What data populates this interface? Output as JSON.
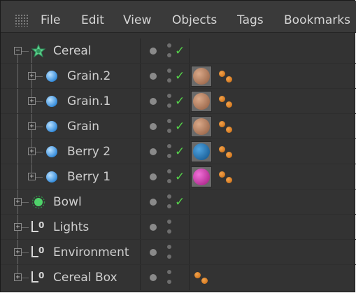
{
  "menu": {
    "items": [
      "File",
      "Edit",
      "View",
      "Objects",
      "Tags",
      "Bookmarks"
    ]
  },
  "colors": {
    "check": "#55d24a",
    "tag_brown": "#a9785a",
    "tag_blue": "#1f6ea8",
    "tag_magenta": "#cf2fa8",
    "particle_orange": "#e08a2a"
  },
  "objects": [
    {
      "label": "Cereal",
      "icon": "cloner-icon",
      "checked": true,
      "material": null,
      "particle_tag": false
    },
    {
      "label": "Grain.2",
      "icon": "sphere-icon",
      "checked": true,
      "material": "brown",
      "particle_tag": true
    },
    {
      "label": "Grain.1",
      "icon": "sphere-icon",
      "checked": true,
      "material": "brown",
      "particle_tag": true
    },
    {
      "label": "Grain",
      "icon": "sphere-icon",
      "checked": true,
      "material": "brown",
      "particle_tag": true
    },
    {
      "label": "Berry 2",
      "icon": "sphere-icon",
      "checked": true,
      "material": "blue",
      "particle_tag": true
    },
    {
      "label": "Berry 1",
      "icon": "sphere-icon",
      "checked": true,
      "material": "magenta",
      "particle_tag": true
    },
    {
      "label": "Bowl",
      "icon": "lathe-icon",
      "checked": true,
      "material": null,
      "particle_tag": false
    },
    {
      "label": "Lights",
      "icon": "null-object-icon",
      "checked": false,
      "material": null,
      "particle_tag": false
    },
    {
      "label": "Environment",
      "icon": "null-object-icon",
      "checked": false,
      "material": null,
      "particle_tag": false
    },
    {
      "label": "Cereal Box",
      "icon": "null-object-icon",
      "checked": false,
      "material": null,
      "particle_tag": true
    }
  ]
}
